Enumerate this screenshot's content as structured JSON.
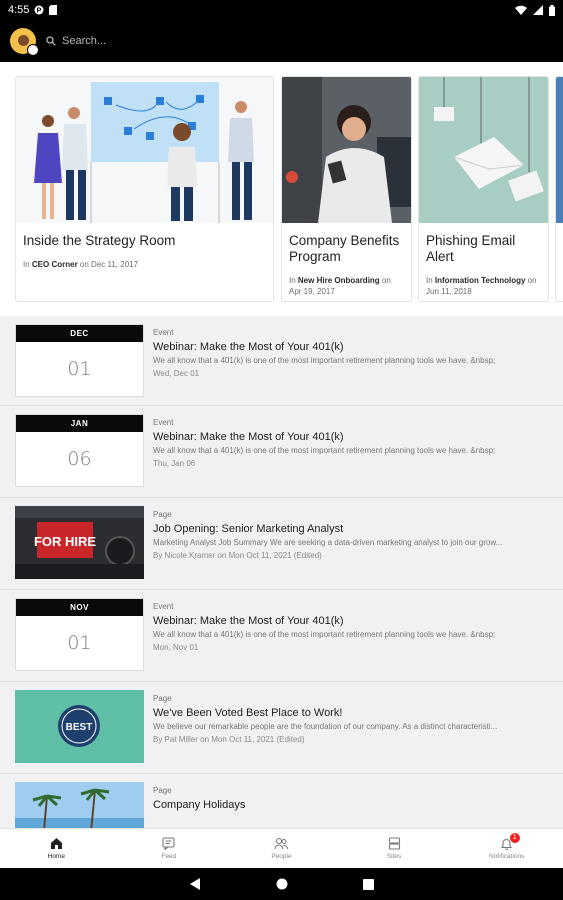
{
  "status_bar": {
    "time": "4:55"
  },
  "app_bar": {
    "search_placeholder": "Search..."
  },
  "carousel": [
    {
      "title": "Inside the Strategy Room",
      "prefix": "In ",
      "category": "CEO Corner",
      "date": " on Dec 11, 2017"
    },
    {
      "title": "Company Benefits Program",
      "prefix": "In ",
      "category": "New Hire Onboarding",
      "date": " on Apr 19, 2017"
    },
    {
      "title": "Phishing Email Alert",
      "prefix": "In ",
      "category": "Information Technology",
      "date": " on Jun 11, 2018"
    }
  ],
  "feed": [
    {
      "kind": "date",
      "month": "DEC",
      "day": "01",
      "type": "Event",
      "title": "Webinar: Make the Most of Your 401(k)",
      "desc": "We all know that a 401(k) is one of the most important retirement planning tools we have. &nbsp;",
      "sub": "Wed, Dec 01"
    },
    {
      "kind": "date",
      "month": "JAN",
      "day": "06",
      "type": "Event",
      "title": "Webinar: Make the Most of Your 401(k)",
      "desc": "We all know that a 401(k) is one of the most important retirement planning tools we have. &nbsp;",
      "sub": "Thu, Jan 06"
    },
    {
      "kind": "hire",
      "sign": "FOR HIRE",
      "type": "Page",
      "title": "Job Opening: Senior Marketing Analyst",
      "desc": "Marketing Analyst Job Summary We are seeking a data-driven marketing analyst to join our grow...",
      "sub": "By Nicole Kramer on Mon Oct 11, 2021 (Edited)"
    },
    {
      "kind": "date",
      "month": "NOV",
      "day": "01",
      "type": "Event",
      "title": "Webinar: Make the Most of Your 401(k)",
      "desc": "We all know that a 401(k) is one of the most important retirement planning tools we have. &nbsp;",
      "sub": "Mon, Nov 01"
    },
    {
      "kind": "best",
      "badge": "BEST",
      "type": "Page",
      "title": "We've Been Voted Best Place to Work!",
      "desc": "We believe our remarkable people are the foundation of our company. As a distinct characteristi...",
      "sub": "By Pat Miller on Mon Oct 11, 2021 (Edited)"
    },
    {
      "kind": "beach",
      "type": "Page",
      "title": "Company Holidays",
      "desc": "",
      "sub": ""
    }
  ],
  "bottom_nav": [
    {
      "label": "Home",
      "icon": "home-icon",
      "active": true
    },
    {
      "label": "Feed",
      "icon": "feed-icon",
      "active": false
    },
    {
      "label": "People",
      "icon": "people-icon",
      "active": false
    },
    {
      "label": "Sites",
      "icon": "sites-icon",
      "active": false
    },
    {
      "label": "Notifications",
      "icon": "bell-icon",
      "active": false,
      "badge": "1"
    }
  ],
  "colors": {
    "accent_badge": "#e22222",
    "teal_card": "#5fbfa6",
    "app_bar": "#000000"
  }
}
